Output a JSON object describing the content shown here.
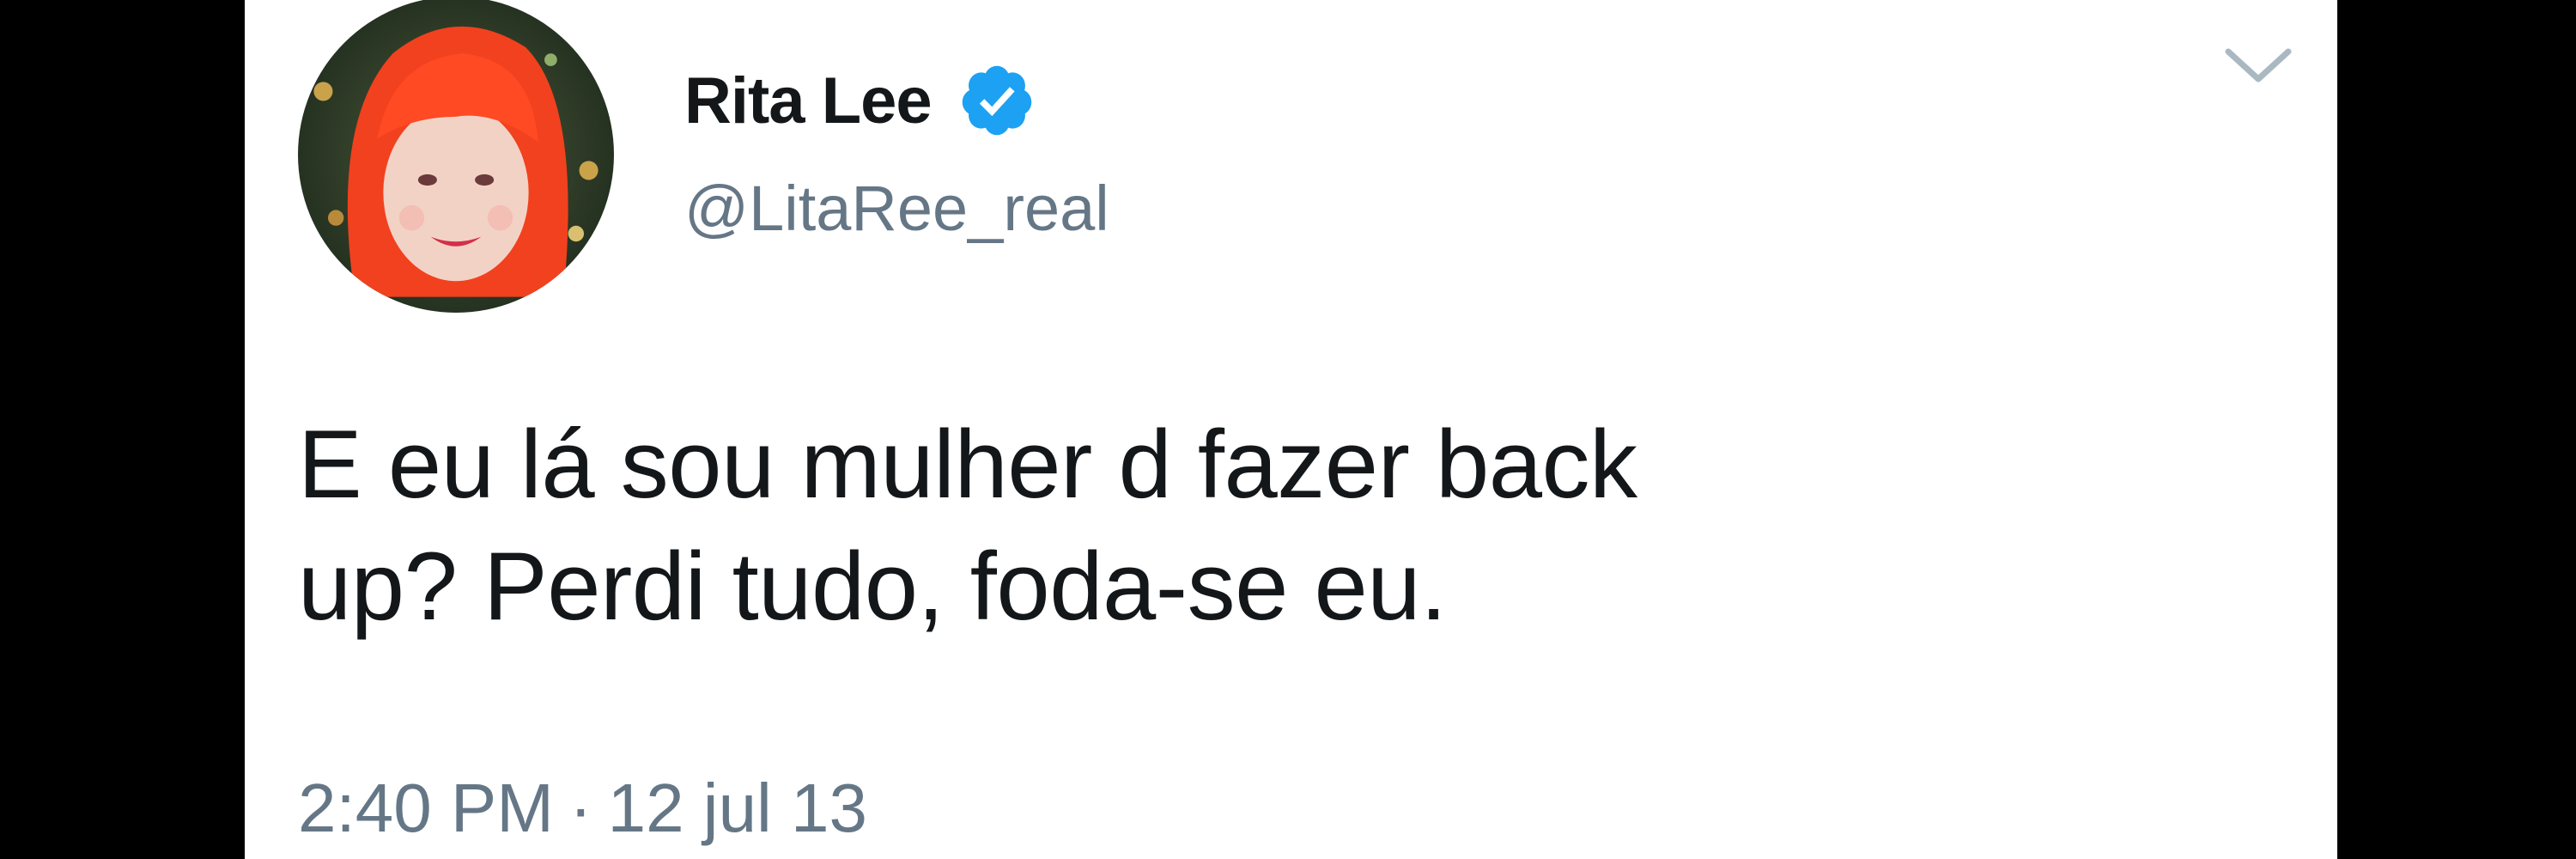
{
  "tweet": {
    "display_name": "Rita Lee",
    "verified": true,
    "handle": "@LitaRee_real",
    "text_lines": [
      "E eu lá sou mulher d fazer back",
      "up? Perdi tudo, foda-se eu."
    ],
    "time": "2:40 PM",
    "separator": "·",
    "date": "12 jul 13"
  },
  "icons": {
    "verified": "verified-badge-icon",
    "menu": "chevron-down-icon"
  },
  "colors": {
    "background": "#000000",
    "card": "#ffffff",
    "text": "#14171a",
    "secondary": "#657786",
    "verified": "#1da1f2",
    "hair": "#f2411e"
  }
}
